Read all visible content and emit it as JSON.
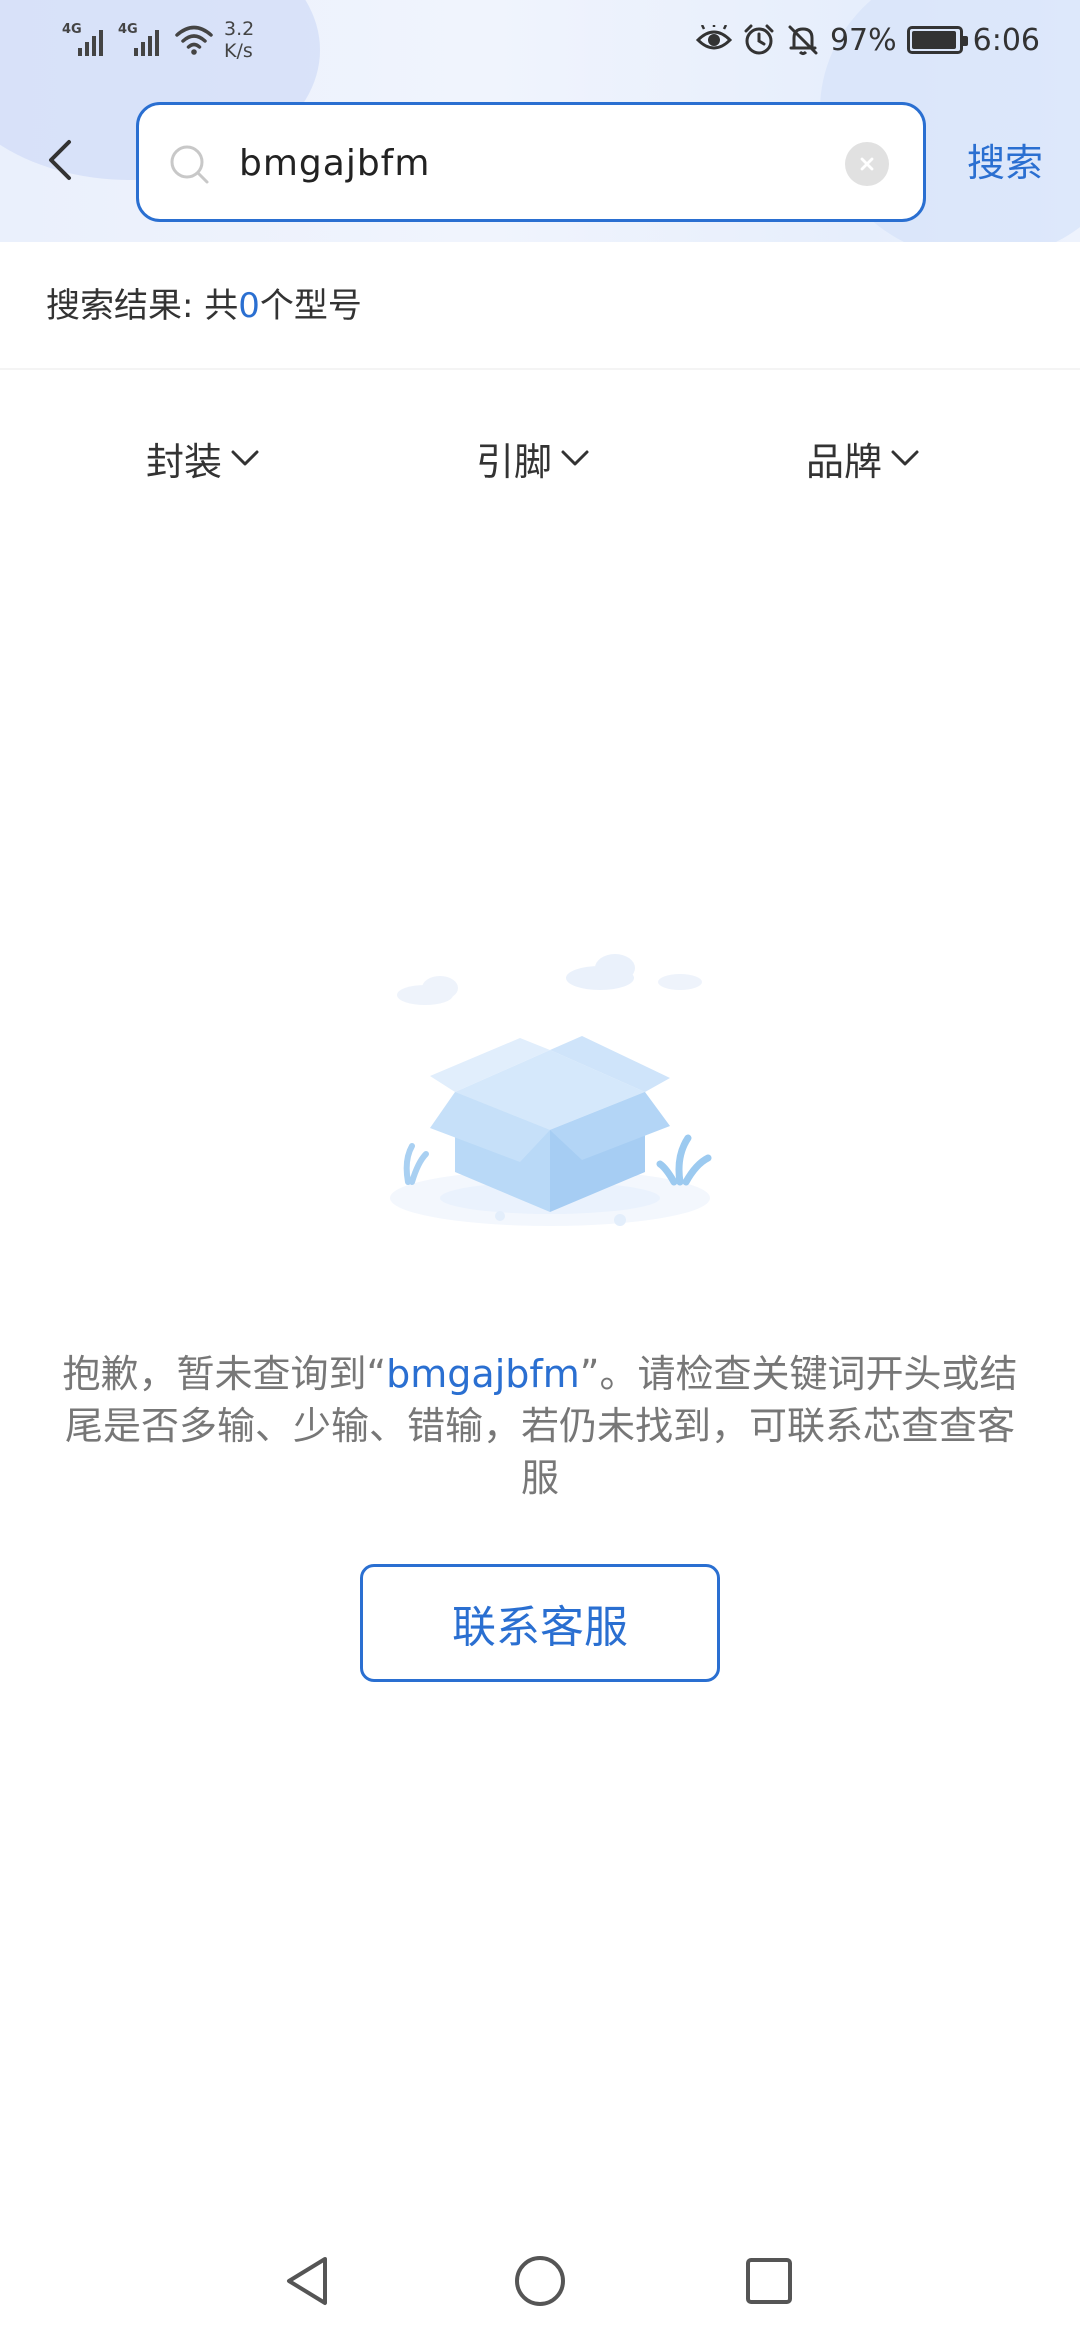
{
  "status_bar": {
    "signal1_label": "4G",
    "signal2_label": "4G",
    "net_speed_value": "3.2",
    "net_speed_unit": "K/s",
    "battery_percent": "97%",
    "battery_level": 0.97,
    "time": "6:06",
    "icons": [
      "eye-icon",
      "alarm-icon",
      "bell-muted-icon",
      "battery-icon"
    ]
  },
  "search": {
    "value": "bmgajbfm",
    "button_label": "搜索"
  },
  "results": {
    "prefix": "搜索结果: 共",
    "count": "0",
    "suffix": "个型号"
  },
  "filters": [
    {
      "label": "封装"
    },
    {
      "label": "引脚"
    },
    {
      "label": "品牌"
    }
  ],
  "empty_state": {
    "message_before": "抱歉，暂未查询到“",
    "keyword": "bmgajbfm",
    "message_after": "”。请检查关键词开头或结尾是否多输、少输、错输，若仍未找到，可联系芯查查客服",
    "contact_button": "联系客服"
  },
  "colors": {
    "accent": "#2a6fd1",
    "text": "#333333",
    "muted_text": "#777777"
  }
}
